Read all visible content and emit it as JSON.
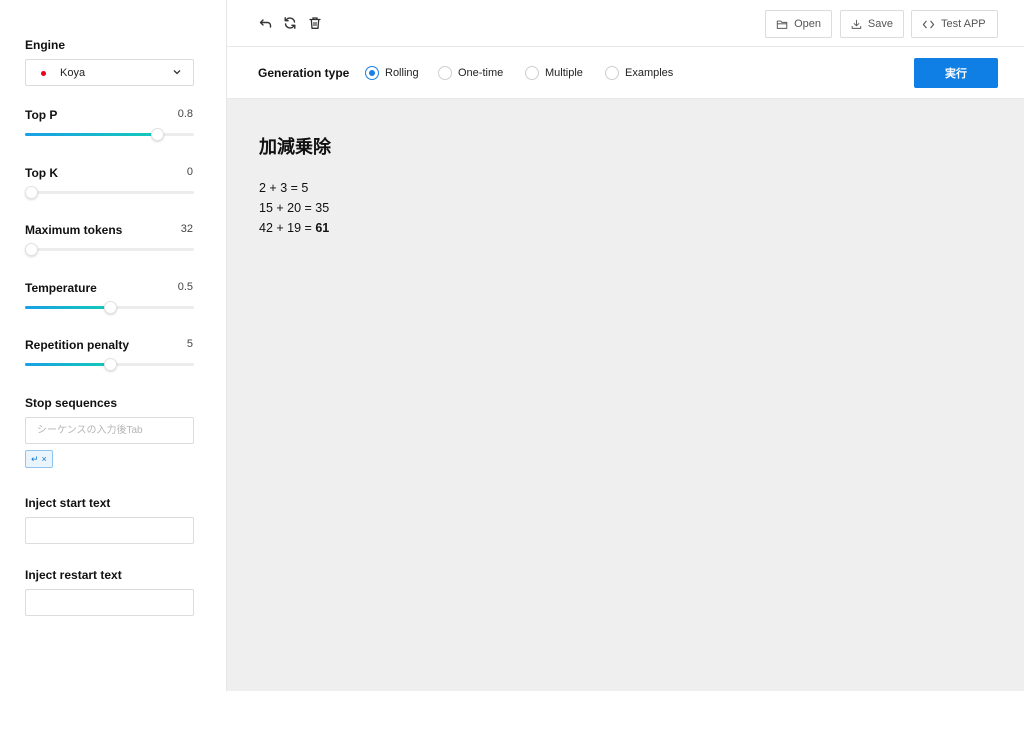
{
  "sidebar": {
    "engine": {
      "label": "Engine",
      "value": "Koya"
    },
    "top_p": {
      "label": "Top P",
      "value": "0.8",
      "fraction": 0.78
    },
    "top_k": {
      "label": "Top K",
      "value": "0",
      "fraction": 0.0
    },
    "max_tokens": {
      "label": "Maximum tokens",
      "value": "32",
      "fraction": 0.02
    },
    "temperature": {
      "label": "Temperature",
      "value": "0.5",
      "fraction": 0.5
    },
    "repetition_penalty": {
      "label": "Repetition penalty",
      "value": "5",
      "fraction": 0.5
    },
    "stop_sequences": {
      "label": "Stop sequences",
      "placeholder": "シーケンスの入力後Tab",
      "chip_symbol": "↵",
      "chip_remove": "×"
    },
    "inject_start": {
      "label": "Inject start text",
      "value": ""
    },
    "inject_restart": {
      "label": "Inject restart text",
      "value": ""
    }
  },
  "toolbar": {
    "undo_icon": "undo-icon",
    "refresh_icon": "refresh-icon",
    "delete_icon": "trash-icon",
    "open_label": "Open",
    "save_label": "Save",
    "test_label": "Test APP"
  },
  "generation": {
    "label": "Generation type",
    "options": [
      "Rolling",
      "One-time",
      "Multiple",
      "Examples"
    ],
    "selected": "Rolling",
    "run_label": "実行"
  },
  "document": {
    "title": "加減乗除",
    "lines": [
      {
        "text": "2 + 3 = 5",
        "generated": ""
      },
      {
        "text": "15 + 20 = 35",
        "generated": ""
      },
      {
        "text": "42 + 19 = ",
        "generated": "61"
      }
    ]
  },
  "colors": {
    "accent": "#0f7fe6",
    "engine_dot": "#e8001c",
    "content_bg": "#efefef"
  }
}
